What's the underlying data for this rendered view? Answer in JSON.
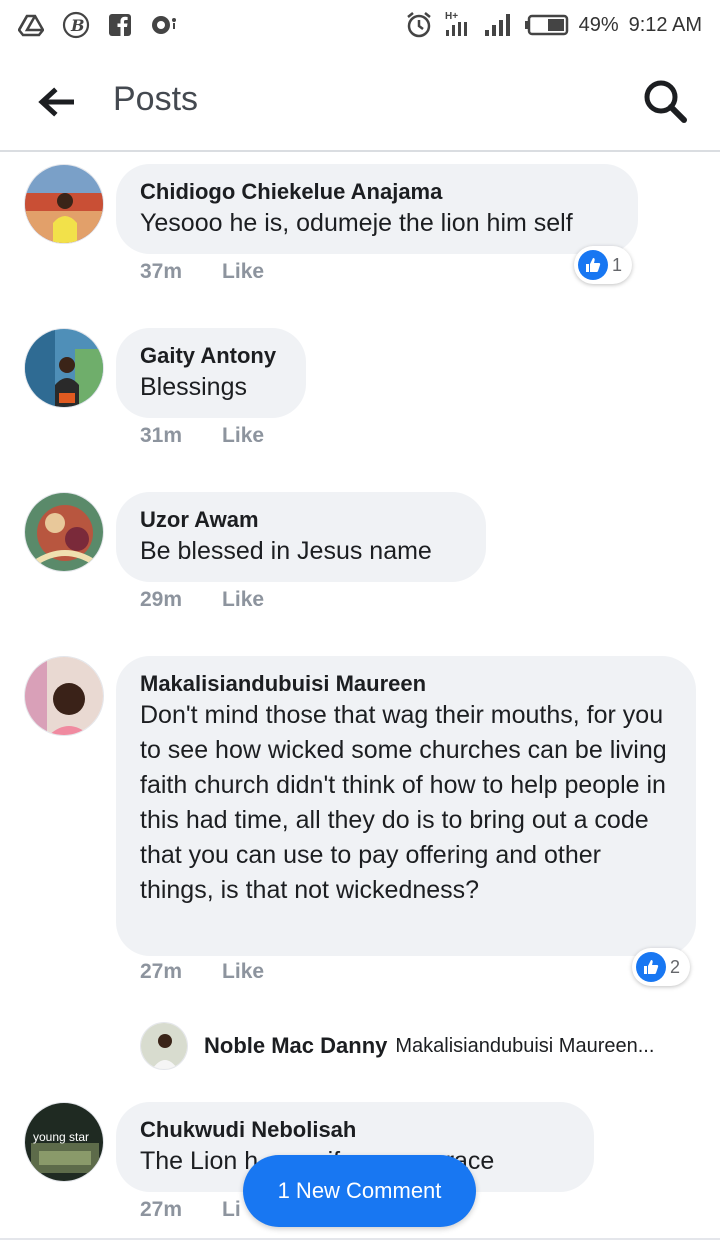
{
  "status_bar": {
    "battery": "49%",
    "time": "9:12 AM",
    "network": "H+",
    "icons": [
      "drive-icon",
      "b-circle-icon",
      "facebook-icon",
      "messenger-icon",
      "alarm-icon",
      "signal-icon",
      "battery-icon"
    ]
  },
  "header": {
    "title": "Posts",
    "back_icon": "arrow-left-icon",
    "search_icon": "search-icon"
  },
  "comments": [
    {
      "author": "Chidiogo Chiekelue Anajama",
      "text": "Yesooo he is, odumeje the lion him self",
      "time": "37m",
      "like_label": "Like",
      "reactions": "1"
    },
    {
      "author": "Gaity Antony",
      "text": "Blessings",
      "time": "31m",
      "like_label": "Like"
    },
    {
      "author": "Uzor Awam",
      "text": "Be blessed in Jesus name",
      "time": "29m",
      "like_label": "Like"
    },
    {
      "author": "Makalisiandubuisi Maureen",
      "text": "Don't mind those that wag their mouths, for you to see how wicked some churches can be living faith church didn't think of how to help people in this had time, all they do is to bring out a code that you can use to pay offering and other things, is that not wickedness?",
      "time": "27m",
      "like_label": "Like",
      "reactions": "2"
    },
    {
      "author": "Chukwudi Nebolisah",
      "text": "The Lion h          if         re grace",
      "time": "27m",
      "like_label": "Li"
    }
  ],
  "reply_preview": {
    "author": "Noble Mac Danny",
    "text": "Makalisiandubuisi Maureen..."
  },
  "avatar_overlay_text": "young star",
  "new_comment_button": "1 New Comment",
  "colors": {
    "accent": "#1877f2",
    "bubble": "#f0f2f5",
    "meta": "#8d949e"
  }
}
